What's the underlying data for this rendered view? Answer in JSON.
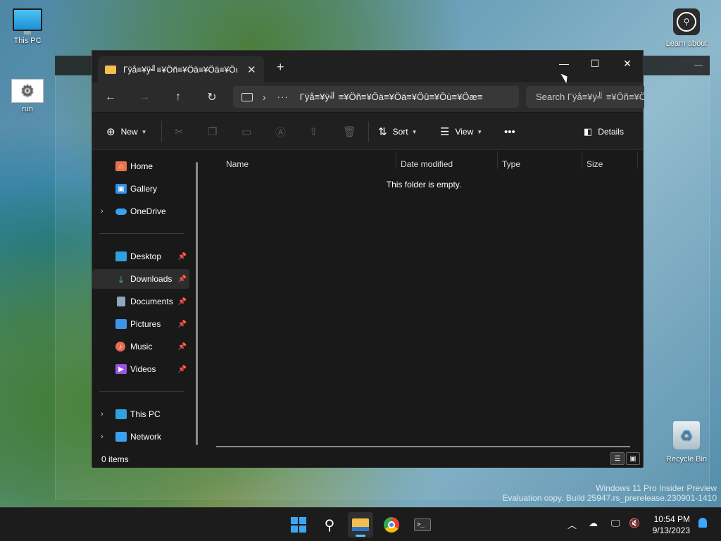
{
  "desktop": {
    "icons": [
      {
        "label": "This PC",
        "icon": "monitor-icon"
      },
      {
        "label": "run",
        "icon": "gear-icon"
      },
      {
        "label": "Learn about",
        "icon": "learn-about-icon"
      },
      {
        "label": "Recycle Bin",
        "icon": "recycle-bin-icon"
      }
    ],
    "watermark": {
      "line1": "Windows 11 Pro Insider Preview",
      "line2": "Evaluation copy. Build 25947.rs_prerelease.230901-1410"
    }
  },
  "explorer": {
    "tab_title": "Γÿå≡¥ÿ╝≡¥Öñ≡¥Öä≡¥Öä≡¥Öı",
    "address_text": "Γÿå≡¥ÿ╝ ≡¥Öñ≡¥Öä≡¥Öä≡¥Öû≡¥Öù≡¥Öæ≡",
    "search_placeholder": "Search Γÿå≡¥ÿ╝ ≡¥Öñ≡¥Öª",
    "toolbar": {
      "new_label": "New",
      "sort_label": "Sort",
      "view_label": "View",
      "details_label": "Details"
    },
    "sidebar": {
      "quick": [
        {
          "label": "Home",
          "icon": "home-icon",
          "color": "#e8734a"
        },
        {
          "label": "Gallery",
          "icon": "gallery-icon",
          "color": "#2f8ee6"
        },
        {
          "label": "OneDrive",
          "icon": "cloud-icon",
          "color": "#3aa0ef"
        }
      ],
      "pinned": [
        {
          "label": "Desktop",
          "icon": "desktop-icon",
          "color": "#2fa0e0"
        },
        {
          "label": "Downloads",
          "icon": "download-icon",
          "color": "#2fc08c"
        },
        {
          "label": "Documents",
          "icon": "document-icon",
          "color": "#8fa5c0"
        },
        {
          "label": "Pictures",
          "icon": "pictures-icon",
          "color": "#3d94e8"
        },
        {
          "label": "Music",
          "icon": "music-icon",
          "color": "#e86a55"
        },
        {
          "label": "Videos",
          "icon": "videos-icon",
          "color": "#9a55e0"
        }
      ],
      "devices": [
        {
          "label": "This PC",
          "icon": "monitor-icon",
          "color": "#2fa0e0"
        },
        {
          "label": "Network",
          "icon": "network-icon",
          "color": "#3aa0ef"
        }
      ]
    },
    "columns": [
      "Name",
      "Date modified",
      "Type",
      "Size"
    ],
    "empty_message": "This folder is empty.",
    "status": "0 items"
  },
  "taskbar": {
    "time": "10:54 PM",
    "date": "9/13/2023"
  }
}
